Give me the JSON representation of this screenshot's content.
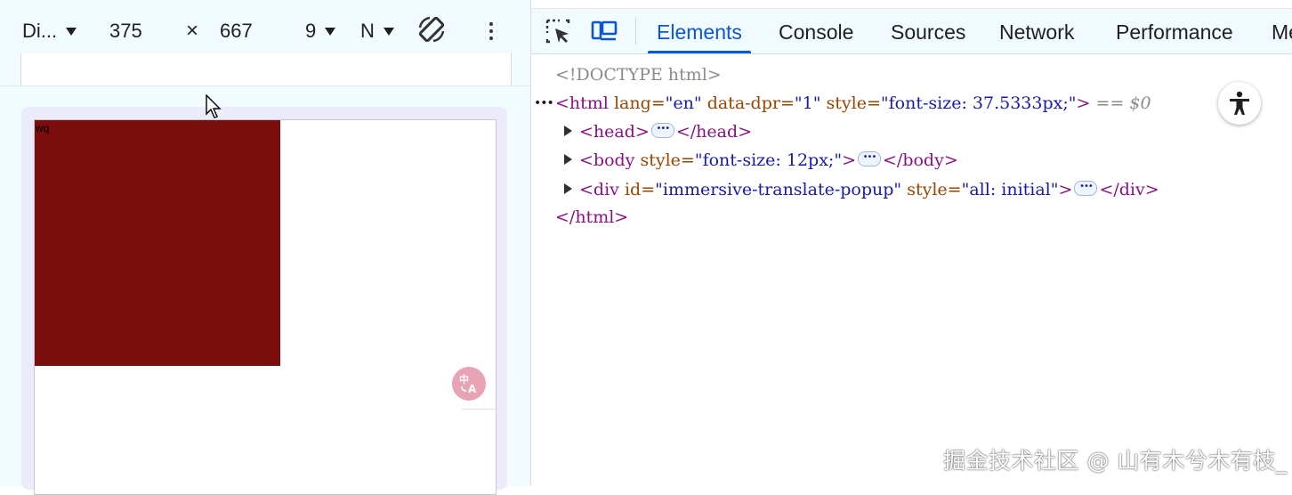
{
  "device_toolbar": {
    "device_label": "Di...",
    "width": "375",
    "times": "×",
    "height": "667",
    "zoom_label": "9",
    "throttle_label": "N"
  },
  "viewport": {
    "red_box_text": "wq"
  },
  "devtools": {
    "tabs": [
      "Elements",
      "Console",
      "Sources",
      "Network",
      "Performance",
      "Me"
    ],
    "active_tab": "Elements"
  },
  "dom": {
    "doctype": "<!DOCTYPE html>",
    "html_open_tag": "<html",
    "html_lang_attr": "lang=",
    "html_lang_val": "\"en\"",
    "html_dpr_attr": "data-dpr=",
    "html_dpr_val": "\"1\"",
    "html_style_attr": "style=",
    "html_style_val": "\"font-size: 37.5333px;\"",
    "html_close_bracket": ">",
    "eq_dollar": "== $0",
    "head_open": "<head>",
    "head_close": "</head>",
    "body_open": "<body",
    "body_style_attr": "style=",
    "body_style_val": "\"font-size: 12px;\"",
    "body_close": "</body>",
    "div_open": "<div",
    "div_id_attr": "id=",
    "div_id_val": "\"immersive-translate-popup\"",
    "div_style_attr": "style=",
    "div_style_val": "\"all: initial\"",
    "div_close": "</div>",
    "html_close": "</html>"
  },
  "watermark": "掘金技术社区 @ 山有木兮木有枝_",
  "colors": {
    "accent": "#0b57d0",
    "red_box": "#7b0d0d",
    "translate_button": "#e8a3b4"
  }
}
